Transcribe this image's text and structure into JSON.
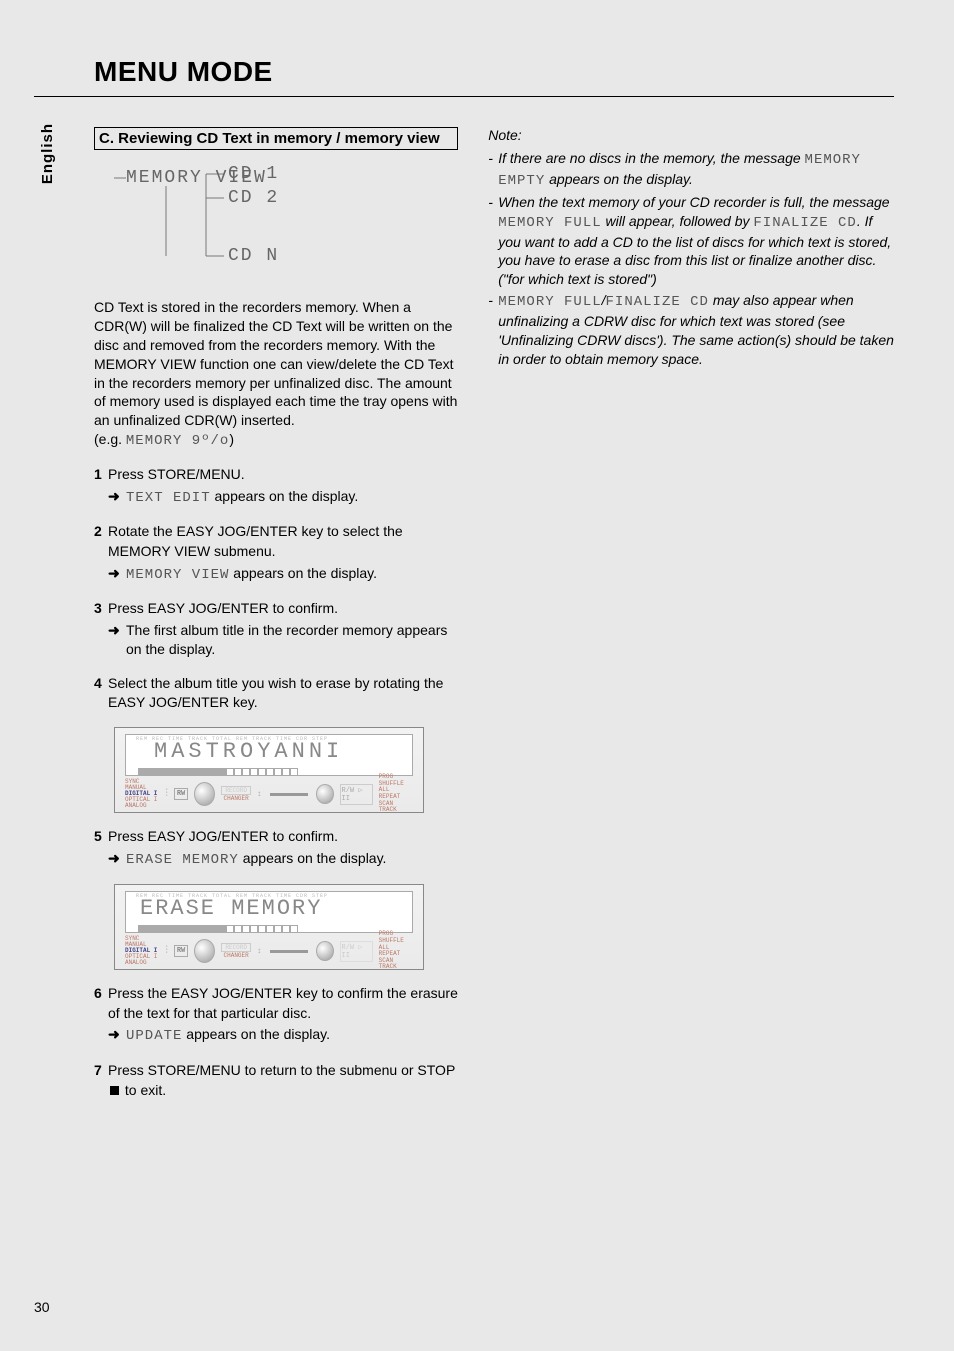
{
  "title": "MENU MODE",
  "language_tab": "English",
  "page_number": "30",
  "section_c": {
    "heading": "C. Reviewing CD Text in memory / memory view",
    "diagram": {
      "root": "MEMORY VIEW",
      "leaf1": "CD 1",
      "leaf2": "CD 2",
      "leafn": "CD N"
    },
    "intro_1": "CD Text is stored in the recorders memory. When a CDR(W) will be finalized the CD Text will be written on the disc and removed from the recorders memory. With the MEMORY VIEW function one can view/delete the CD Text in the recorders memory per unfinalized disc. The amount of memory used is displayed each time the tray opens with an unfinalized CDR(W) inserted.",
    "intro_eg_prefix": "(e.g. ",
    "intro_eg_seg": "MEMORY 9º/o",
    "intro_eg_suffix": ")",
    "steps": {
      "s1": {
        "num": "1",
        "text": "Press STORE/MENU.",
        "sub_seg": "TEXT EDIT",
        "sub_tail": " appears on the display."
      },
      "s2": {
        "num": "2",
        "text": "Rotate the EASY JOG/ENTER key to select the MEMORY VIEW submenu.",
        "sub_seg": "MEMORY VIEW",
        "sub_tail": " appears on the display."
      },
      "s3": {
        "num": "3",
        "text": "Press EASY JOG/ENTER to confirm.",
        "sub_plain": "The first album title in the recorder memory appears on the display."
      },
      "s4": {
        "num": "4",
        "text": "Select the album title you wish to erase by rotating the EASY JOG/ENTER key."
      },
      "s5": {
        "num": "5",
        "text": "Press EASY JOG/ENTER to confirm.",
        "sub_seg": "ERASE MEMORY",
        "sub_tail": " appears on the display."
      },
      "s6": {
        "num": "6",
        "text": "Press the EASY JOG/ENTER key to confirm the erasure of the text for that particular disc.",
        "sub_seg": "UPDATE",
        "sub_tail": " appears on the display."
      },
      "s7": {
        "num": "7",
        "text_a": "Press STORE/MENU to return to the submenu or STOP ",
        "text_b": " to exit."
      }
    },
    "device1": {
      "lcd": "MASTROYANNI",
      "top_labels": "REM  REC  TIME TRACK        TOTAL  REM  TRACK  TIME           CDR   STEP",
      "left1": "SYNC MANUAL",
      "left2": "DIGITAL I",
      "left3": "OPTICAL I",
      "left4": "ANALOG",
      "rw": "RW",
      "mid1": "RECORD",
      "mid2": "CHANGER",
      "r1": "PROG",
      "r2": "SHUFFLE   ALL",
      "r3": "REPEAT",
      "r4": "SCAN   TRACK"
    },
    "device2": {
      "lcd": "ERASE  MEMORY"
    }
  },
  "notes": {
    "heading": "Note:",
    "n1_a": "If there are no discs in the memory, the message ",
    "n1_seg": "MEMORY EMPTY",
    "n1_b": " appears on the display.",
    "n2_a": "When the text memory of your CD recorder is full, the message ",
    "n2_seg1": "MEMORY FULL",
    "n2_b": " will appear, followed by ",
    "n2_seg2": "FINALIZE CD",
    "n2_c": ". If you want to add a CD to the list of discs for which text is stored, you have to erase a disc from this list or finalize another disc. (\"for which text is stored\")",
    "n3_seg": "MEMORY FULL",
    "n3_slash": "/",
    "n3_seg2": "FINALIZE CD",
    "n3_a": " may also appear when unfinalizing a CDRW disc for which text was stored (see 'Unfinalizing CDRW discs'). The same action(s) should be taken in order to obtain memory space."
  }
}
